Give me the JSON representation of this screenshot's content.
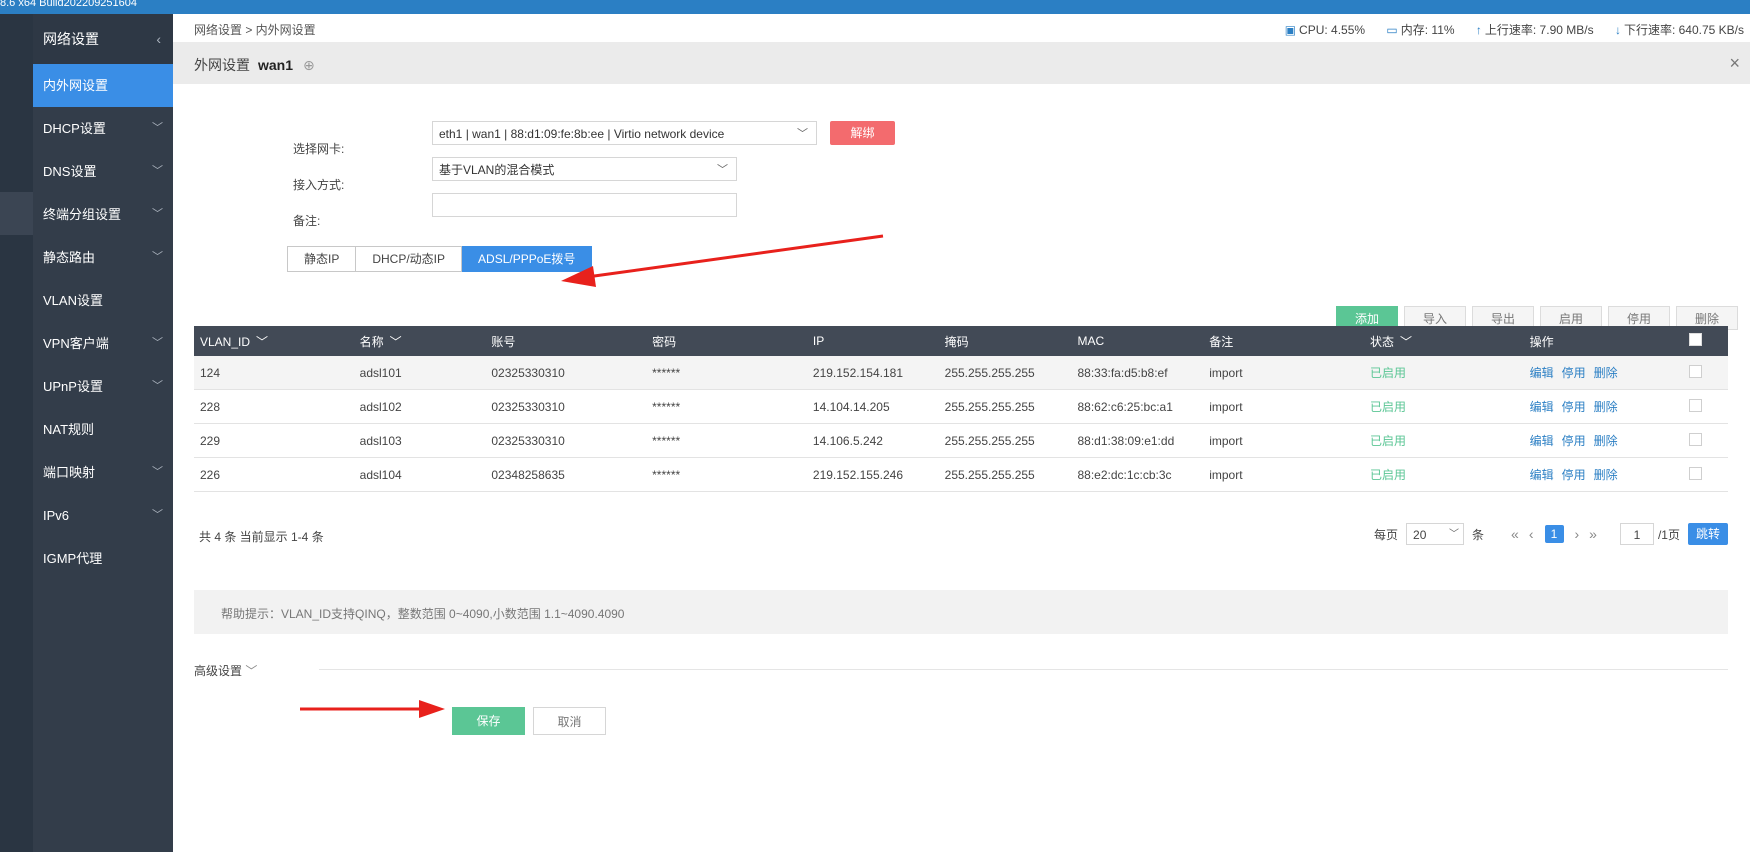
{
  "window": {
    "build_text": "8.6 x64 Build202209251604"
  },
  "sidebar": {
    "title": "网络设置",
    "items": [
      {
        "label": "内外网设置",
        "active": true,
        "chevron": false
      },
      {
        "label": "DHCP设置",
        "chevron": true
      },
      {
        "label": "DNS设置",
        "chevron": true
      },
      {
        "label": "终端分组设置",
        "chevron": true
      },
      {
        "label": "静态路由",
        "chevron": true
      },
      {
        "label": "VLAN设置",
        "chevron": false
      },
      {
        "label": "VPN客户端",
        "chevron": true
      },
      {
        "label": "UPnP设置",
        "chevron": true
      },
      {
        "label": "NAT规则",
        "chevron": false
      },
      {
        "label": "端口映射",
        "chevron": true
      },
      {
        "label": "IPv6",
        "chevron": true
      },
      {
        "label": "IGMP代理",
        "chevron": false
      }
    ]
  },
  "breadcrumb": "网络设置 > 内外网设置",
  "stats": {
    "cpu": "CPU: 4.55%",
    "mem": "内存: 11%",
    "up": "上行速率: 7.90 MB/s",
    "down": "下行速率: 640.75 KB/s"
  },
  "panel": {
    "title": "外网设置",
    "name": "wan1"
  },
  "form": {
    "nic_label": "选择网卡:",
    "nic_value": "eth1 | wan1 | 88:d1:09:fe:8b:ee | Virtio network device",
    "unbind_label": "解绑",
    "mode_label": "接入方式:",
    "mode_value": "基于VLAN的混合模式",
    "note_label": "备注:",
    "note_value": ""
  },
  "mode_tabs": [
    "静态IP",
    "DHCP/动态IP",
    "ADSL/PPPoE拨号"
  ],
  "toolbar": {
    "add": "添加",
    "import": "导入",
    "export": "导出",
    "enable": "启用",
    "disable": "停用",
    "delete": "删除"
  },
  "table": {
    "columns": [
      "VLAN_ID",
      "名称",
      "账号",
      "密码",
      "IP",
      "掩码",
      "MAC",
      "备注",
      "状态",
      "操作"
    ],
    "sortable": [
      true,
      true,
      false,
      false,
      false,
      false,
      false,
      false,
      true,
      false
    ],
    "rows": [
      {
        "vlan_id": "124",
        "name": "adsl101",
        "account": "02325330310",
        "password": "******",
        "ip": "219.152.154.181",
        "mask": "255.255.255.255",
        "mac": "88:33:fa:d5:b8:ef",
        "note": "import",
        "status": "已启用"
      },
      {
        "vlan_id": "228",
        "name": "adsl102",
        "account": "02325330310",
        "password": "******",
        "ip": "14.104.14.205",
        "mask": "255.255.255.255",
        "mac": "88:62:c6:25:bc:a1",
        "note": "import",
        "status": "已启用"
      },
      {
        "vlan_id": "229",
        "name": "adsl103",
        "account": "02325330310",
        "password": "******",
        "ip": "14.106.5.242",
        "mask": "255.255.255.255",
        "mac": "88:d1:38:09:e1:dd",
        "note": "import",
        "status": "已启用"
      },
      {
        "vlan_id": "226",
        "name": "adsl104",
        "account": "02348258635",
        "password": "******",
        "ip": "219.152.155.246",
        "mask": "255.255.255.255",
        "mac": "88:e2:dc:1c:cb:3c",
        "note": "import",
        "status": "已启用"
      }
    ],
    "ops": {
      "edit": "编辑",
      "disable": "停用",
      "delete": "删除"
    }
  },
  "summary": "共 4 条 当前显示 1-4 条",
  "pager": {
    "per_page_label": "每页",
    "per_page": "20",
    "unit": "条",
    "current": "1",
    "jump_value": "1",
    "total": "/1页",
    "go": "跳转"
  },
  "help": "帮助提示：VLAN_ID支持QINQ，整数范围 0~4090,小数范围 1.1~4090.4090",
  "advanced": "高级设置",
  "actions": {
    "save": "保存",
    "cancel": "取消"
  },
  "colors": {
    "accent": "#3a8ee6",
    "success": "#5bc695",
    "danger": "#f36b6e",
    "sidebar": "#333d4a",
    "annotation_arrow": "#e8211c"
  }
}
